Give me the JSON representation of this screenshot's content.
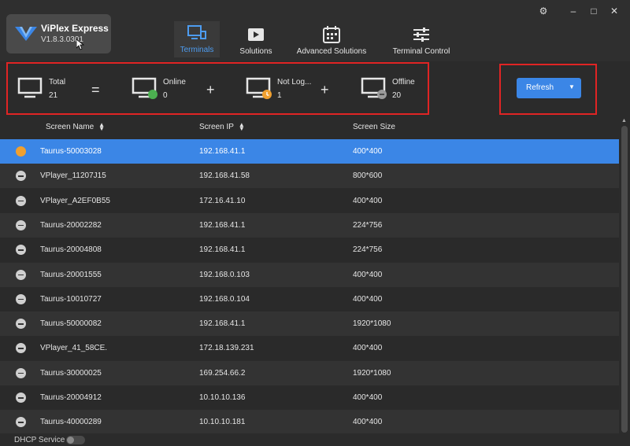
{
  "app": {
    "name": "ViPlex Express",
    "version": "V1.8.3.0301"
  },
  "nav": [
    {
      "label": "Terminals",
      "icon": "terminals-icon",
      "active": true
    },
    {
      "label": "Solutions",
      "icon": "solutions-icon",
      "active": false
    },
    {
      "label": "Advanced Solutions",
      "icon": "calendar-icon",
      "active": false
    },
    {
      "label": "Terminal Control",
      "icon": "sliders-icon",
      "active": false
    }
  ],
  "summary": {
    "total_label": "Total",
    "total_value": "21",
    "online_label": "Online",
    "online_value": "0",
    "notlogged_label": "Not Log...",
    "notlogged_value": "1",
    "offline_label": "Offline",
    "offline_value": "20",
    "eq": "=",
    "plus": "+"
  },
  "annotations": {
    "box1": "1",
    "box2": "2"
  },
  "refresh": {
    "label": "Refresh"
  },
  "table": {
    "headers": {
      "name": "Screen Name",
      "ip": "Screen IP",
      "size": "Screen Size"
    },
    "rows": [
      {
        "status": "not-logged",
        "name": "Taurus-50003028",
        "ip": "192.168.41.1",
        "size": "400*400"
      },
      {
        "status": "offline",
        "name": "VPlayer_11207J15",
        "ip": "192.168.41.58",
        "size": "800*600"
      },
      {
        "status": "offline",
        "name": "VPlayer_A2EF0B55",
        "ip": "172.16.41.10",
        "size": "400*400"
      },
      {
        "status": "offline",
        "name": "Taurus-20002282",
        "ip": "192.168.41.1",
        "size": "224*756"
      },
      {
        "status": "offline",
        "name": "Taurus-20004808",
        "ip": "192.168.41.1",
        "size": "224*756"
      },
      {
        "status": "offline",
        "name": "Taurus-20001555",
        "ip": "192.168.0.103",
        "size": "400*400"
      },
      {
        "status": "offline",
        "name": "Taurus-10010727",
        "ip": "192.168.0.104",
        "size": "400*400"
      },
      {
        "status": "offline",
        "name": "Taurus-50000082",
        "ip": "192.168.41.1",
        "size": "1920*1080"
      },
      {
        "status": "offline",
        "name": "VPlayer_41_58CE.",
        "ip": "172.18.139.231",
        "size": "400*400"
      },
      {
        "status": "offline",
        "name": "Taurus-30000025",
        "ip": "169.254.66.2",
        "size": "1920*1080"
      },
      {
        "status": "offline",
        "name": "Taurus-20004912",
        "ip": "10.10.10.136",
        "size": "400*400"
      },
      {
        "status": "offline",
        "name": "Taurus-40000289",
        "ip": "10.10.10.181",
        "size": "400*400"
      }
    ]
  },
  "footer": {
    "dhcp_label": "DHCP Service"
  },
  "colors": {
    "accent": "#3b86e6",
    "highlight": "#e02424",
    "online": "#4caf50",
    "not_logged": "#f0a030"
  }
}
